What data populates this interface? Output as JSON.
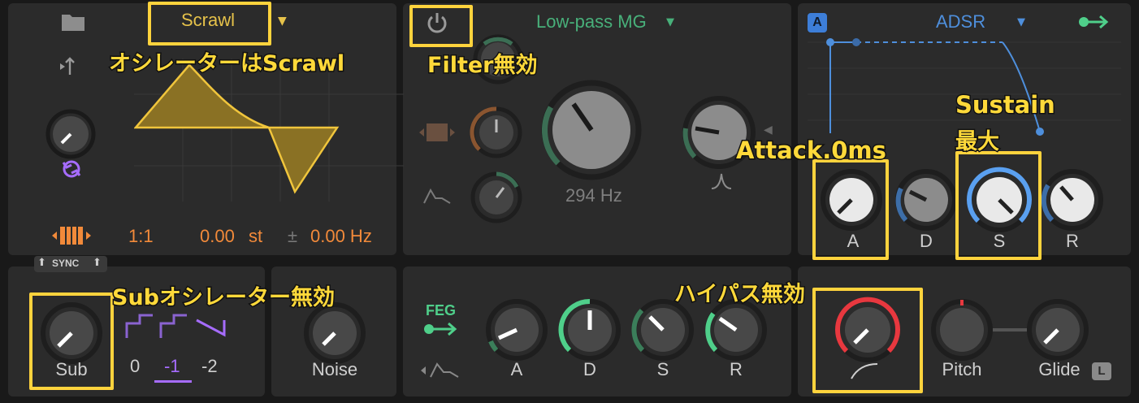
{
  "osc": {
    "waveform": "Scrawl",
    "ratio": "1:1",
    "pitch_value": "0.00",
    "pitch_unit": "st",
    "fine_prefix": "±",
    "fine": "0.00 Hz",
    "sync_label": "SYNC"
  },
  "filter": {
    "type": "Low-pass MG",
    "freq": "294 Hz"
  },
  "env": {
    "type": "ADSR",
    "badge": "A",
    "labels": [
      "A",
      "D",
      "S",
      "R"
    ]
  },
  "sub": {
    "label": "Sub",
    "octaves": [
      "0",
      "-1",
      "-2"
    ]
  },
  "noise": {
    "label": "Noise"
  },
  "feg": {
    "label": "FEG",
    "labels": [
      "A",
      "D",
      "S",
      "R"
    ]
  },
  "misc": {
    "pitch_label": "Pitch",
    "glide_label": "Glide",
    "legato_badge": "L"
  },
  "annotations": {
    "osc": "オシレーターはScrawl",
    "filter": "Filter無効",
    "sustain1": "Sustain",
    "sustain2": "最大",
    "attack": "Attack.0ms",
    "sub": "Subオシレーター無効",
    "hp": "ハイパス無効"
  },
  "colors": {
    "accent_orange": "#f28a3a",
    "accent_green": "#4fcf8a",
    "accent_blue": "#5aa0f0",
    "accent_purple": "#a66cff",
    "accent_red": "#e8383f",
    "annotation": "#ffd93a"
  }
}
